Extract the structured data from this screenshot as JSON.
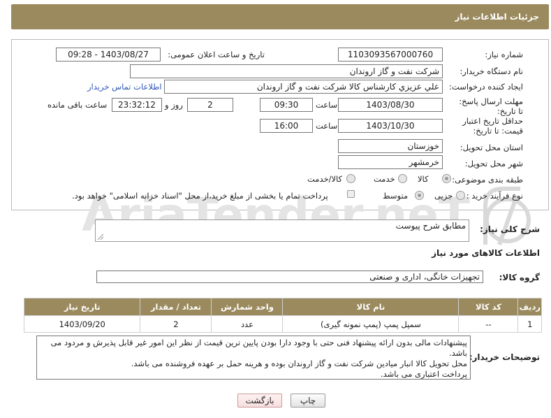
{
  "title": "جزئیات اطلاعات نیاز",
  "need_number": {
    "label": "شماره نیاز:",
    "value": "1103093567000760"
  },
  "announce": {
    "label": "تاریخ و ساعت اعلان عمومی:",
    "value": "1403/08/27 - 09:28"
  },
  "buyer_org": {
    "label": "نام دستگاه خریدار:",
    "value": "شرکت نفت و گاز اروندان"
  },
  "requester": {
    "label": "ایجاد کننده درخواست:",
    "value": "علي عزيزي كارشناس كالا شرکت نفت و گاز اروندان",
    "contact_link": "اطلاعات تماس خریدار"
  },
  "reply_deadline": {
    "label": "مهلت ارسال پاسخ: تا تاریخ:",
    "date": "1403/08/30",
    "time_label": "ساعت",
    "time": "09:30",
    "days": "2",
    "days_label": "روز و",
    "remaining": "23:32:12",
    "remaining_label": "ساعت باقی مانده"
  },
  "price_validity": {
    "label": "حداقل تاریخ اعتبار قیمت: تا تاریخ:",
    "date": "1403/10/30",
    "time_label": "ساعت",
    "time": "16:00"
  },
  "delivery_province": {
    "label": "استان محل تحویل:",
    "value": "خوزستان"
  },
  "delivery_city": {
    "label": "شهر محل تحویل:",
    "value": "خرمشهر"
  },
  "category": {
    "label": "طبقه بندی موضوعی:",
    "options": [
      "کالا",
      "خدمت",
      "کالا/خدمت"
    ],
    "selected": "کالا"
  },
  "process": {
    "label": "نوع فرآیند خرید :",
    "options": [
      "جزیی",
      "متوسط"
    ],
    "selected": "متوسط",
    "payment_text": "پرداخت تمام یا بخشی از مبلغ خرید،از محل \"اسناد خزانه اسلامی\" خواهد بود."
  },
  "description": {
    "label": "شرح کلی نیاز:",
    "value": "مطابق شرح پیوست"
  },
  "goods_info_title": "اطلاعات کالاهای مورد نیاز",
  "goods_group": {
    "label": "گروه کالا:",
    "value": "تجهیزات خانگی، اداری و صنعتی"
  },
  "table": {
    "headers": [
      "ردیف",
      "کد کالا",
      "نام کالا",
      "واحد شمارش",
      "تعداد / مقدار",
      "تاریخ نیاز"
    ],
    "rows": [
      [
        "1",
        "--",
        "سمپل پمپ (پمپ نمونه گیری)",
        "عدد",
        "2",
        "1403/09/20"
      ]
    ]
  },
  "buyer_notes": {
    "label": "توضیحات خریدار:",
    "lines": [
      "پیشنهادات مالی بدون ارائه پیشنهاد فنی حتی با وجود دارا بودن پایین ترین قیمت از نظر این امور غیر قابل پذیرش و مردود می باشد.",
      "محل تحویل کالا انبار میادین شرکت نفت و گاز اروندان بوده و هرینه حمل بر عهده فروشنده می باشد.",
      "پرداخت اعتباری می باشد."
    ]
  },
  "buttons": {
    "print": "چاپ",
    "back": "بازگشت"
  },
  "watermark": "AriaTender.neT",
  "colors": {
    "header_bg": "#9b8a5e",
    "link": "#2d56b8"
  }
}
